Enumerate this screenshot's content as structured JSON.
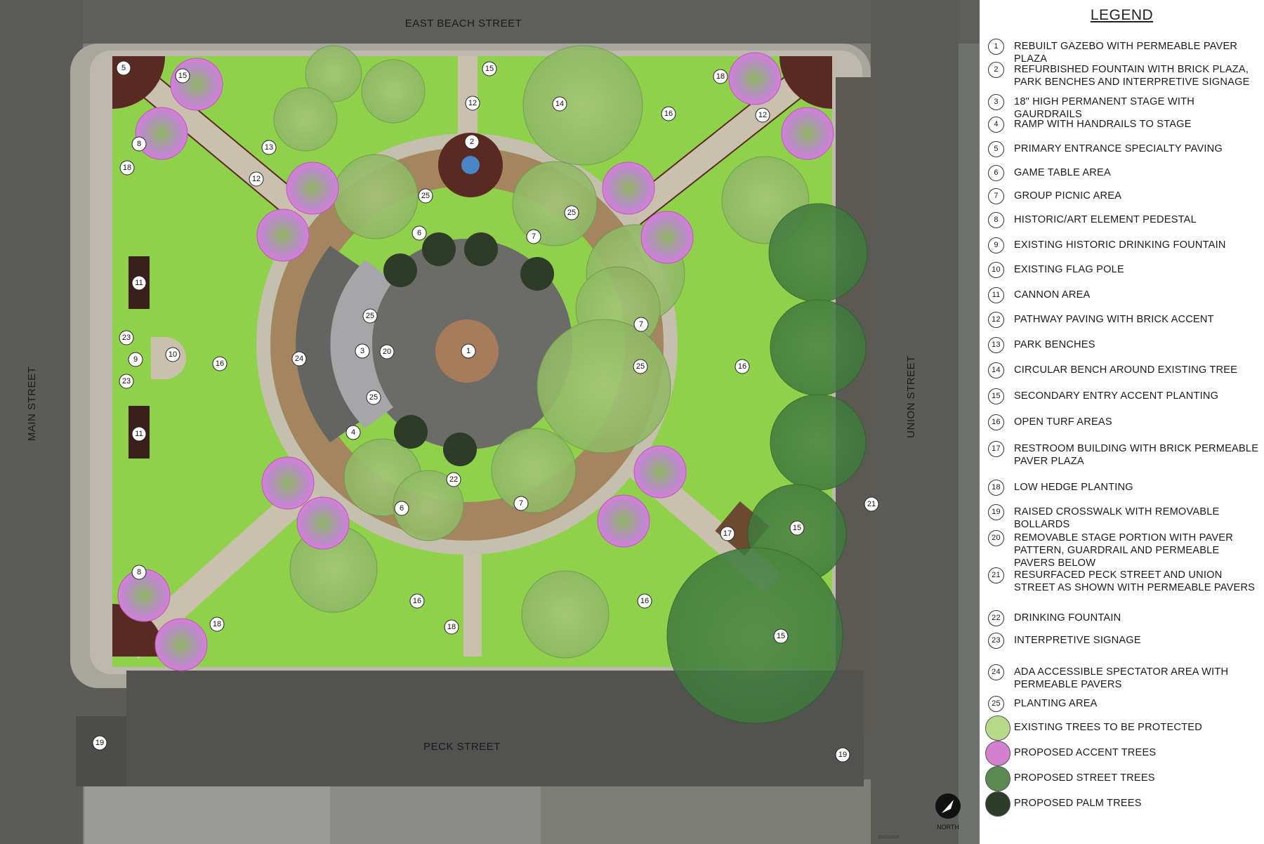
{
  "streets": {
    "north": "EAST BEACH STREET",
    "south": "PECK STREET",
    "west": "MAIN STREET",
    "east": "UNION STREET"
  },
  "legend": {
    "title": "LEGEND",
    "items": [
      {
        "num": "1",
        "text": "REBUILT GAZEBO WITH PERMEABLE PAVER PLAZA"
      },
      {
        "num": "2",
        "text": "REFURBISHED FOUNTAIN WITH BRICK PLAZA, PARK BENCHES AND INTERPRETIVE SIGNAGE"
      },
      {
        "num": "3",
        "text": "18\" HIGH PERMANENT STAGE WITH GAURDRAILS"
      },
      {
        "num": "4",
        "text": "RAMP WITH HANDRAILS TO STAGE"
      },
      {
        "num": "5",
        "text": "PRIMARY ENTRANCE SPECIALTY PAVING"
      },
      {
        "num": "6",
        "text": "GAME TABLE AREA"
      },
      {
        "num": "7",
        "text": "GROUP PICNIC AREA"
      },
      {
        "num": "8",
        "text": "HISTORIC/ART ELEMENT PEDESTAL"
      },
      {
        "num": "9",
        "text": "EXISTING HISTORIC DRINKING FOUNTAIN"
      },
      {
        "num": "10",
        "text": "EXISTING FLAG POLE"
      },
      {
        "num": "11",
        "text": "CANNON AREA"
      },
      {
        "num": "12",
        "text": "PATHWAY PAVING WITH BRICK ACCENT"
      },
      {
        "num": "13",
        "text": "PARK BENCHES"
      },
      {
        "num": "14",
        "text": "CIRCULAR BENCH AROUND EXISTING TREE"
      },
      {
        "num": "15",
        "text": "SECONDARY ENTRY ACCENT PLANTING"
      },
      {
        "num": "16",
        "text": "OPEN TURF AREAS"
      },
      {
        "num": "17",
        "text": "RESTROOM BUILDING WITH BRICK PERMEABLE PAVER PLAZA"
      },
      {
        "num": "18",
        "text": "LOW HEDGE PLANTING"
      },
      {
        "num": "19",
        "text": "RAISED CROSSWALK WITH REMOVABLE BOLLARDS"
      },
      {
        "num": "20",
        "text": "REMOVABLE STAGE PORTION WITH PAVER PATTERN, GUARDRAIL AND PERMEABLE PAVERS BELOW"
      },
      {
        "num": "21",
        "text": "RESURFACED PECK STREET AND UNION STREET AS SHOWN WITH  PERMEABLE PAVERS"
      },
      {
        "num": "22",
        "text": "DRINKING FOUNTAIN"
      },
      {
        "num": "23",
        "text": "INTERPRETIVE SIGNAGE"
      },
      {
        "num": "24",
        "text": "ADA ACCESSIBLE SPECTATOR AREA WITH PERMEABLE PAVERS"
      },
      {
        "num": "25",
        "text": "PLANTING AREA"
      }
    ],
    "symbols": [
      {
        "icon": "existing-tree-icon",
        "text": "EXISTING TREES TO BE PROTECTED",
        "color": "#b7d98a"
      },
      {
        "icon": "accent-tree-icon",
        "text": "PROPOSED ACCENT TREES",
        "color": "#d47fd0"
      },
      {
        "icon": "street-tree-icon",
        "text": "PROPOSED STREET TREES",
        "color": "#5a8a52"
      },
      {
        "icon": "palm-tree-icon",
        "text": "PROPOSED PALM TREES",
        "color": "#2e3b26"
      }
    ]
  },
  "north_arrow": {
    "label": "NORTH"
  },
  "date": "10/02/2019",
  "colors": {
    "turf": "#8fd14a",
    "path": "#c9c1ad",
    "brick": "#5a2a22",
    "plaza": "#6b6b67",
    "gazebo": "#a87c5a",
    "street": "#4a4a48",
    "existing_tree": "#a7c97a",
    "accent_tree": "#d47fd0",
    "street_tree": "#4f8a4a"
  },
  "callouts": {
    "c1": "1",
    "c2": "2",
    "c3": "3",
    "c4": "4",
    "c5": "5",
    "c6": "6",
    "c7": "7",
    "c8": "8",
    "c9": "9",
    "c10": "10",
    "c11": "11",
    "c12": "12",
    "c13": "13",
    "c14": "14",
    "c15": "15",
    "c16": "16",
    "c17": "17",
    "c18": "18",
    "c19": "19",
    "c20": "20",
    "c21": "21",
    "c22": "22",
    "c23": "23",
    "c24": "24",
    "c25": "25"
  }
}
